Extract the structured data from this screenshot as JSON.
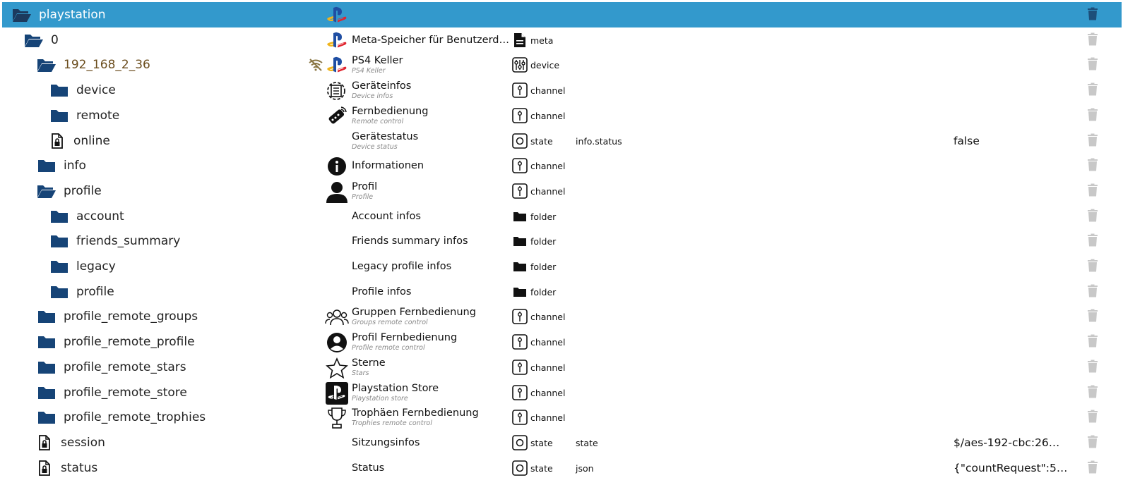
{
  "colors": {
    "selected_bg": "#3399cc",
    "folder": "#164477",
    "delete_icon": "#c8c8c8",
    "delete_icon_selected": "#1d4f7a",
    "device_name_color": "#6b4d1d",
    "connection_icon_color": "#8a7644"
  },
  "tree": [
    {
      "name": "playstation",
      "depth": 0,
      "icon": "folder-open-icon",
      "label": "",
      "sub": "",
      "type": "",
      "type_icon": "",
      "role": "",
      "value": "",
      "obj_icon": "playstation-logo-icon",
      "selected": true
    },
    {
      "name": "0",
      "depth": 1,
      "icon": "folder-open-icon",
      "label": "Meta-Speicher für Benutzerdat…",
      "sub": "",
      "type": "meta",
      "type_icon": "meta-file-icon",
      "role": "",
      "value": "",
      "obj_icon": "playstation-logo-icon"
    },
    {
      "name": "192_168_2_36",
      "depth": 2,
      "icon": "folder-open-icon",
      "label": "PS4 Keller",
      "sub": "PS4 Keller",
      "type": "device",
      "type_icon": "device-icon",
      "role": "",
      "value": "",
      "obj_icon": "playstation-logo-icon",
      "connection": "wifi-off-icon",
      "device": true
    },
    {
      "name": "device",
      "depth": 3,
      "icon": "folder-closed-icon",
      "label": "Geräteinfos",
      "sub": "Device infos",
      "type": "channel",
      "type_icon": "channel-icon",
      "role": "",
      "value": "",
      "obj_icon": "device-settings-icon"
    },
    {
      "name": "remote",
      "depth": 3,
      "icon": "folder-closed-icon",
      "label": "Fernbedienung",
      "sub": "Remote control",
      "type": "channel",
      "type_icon": "channel-icon",
      "role": "",
      "value": "",
      "obj_icon": "remote-control-icon"
    },
    {
      "name": "online",
      "depth": 3,
      "icon": "state-file-lock-icon",
      "label": "Gerätestatus",
      "sub": "Device status",
      "type": "state",
      "type_icon": "state-icon",
      "role": "info.status",
      "value": "false",
      "obj_icon": ""
    },
    {
      "name": "info",
      "depth": 2,
      "icon": "folder-closed-icon",
      "label": "Informationen",
      "sub": "",
      "type": "channel",
      "type_icon": "channel-icon",
      "role": "",
      "value": "",
      "obj_icon": "info-circle-icon"
    },
    {
      "name": "profile",
      "depth": 2,
      "icon": "folder-open-icon",
      "label": "Profil",
      "sub": "Profile",
      "type": "channel",
      "type_icon": "channel-icon",
      "role": "",
      "value": "",
      "obj_icon": "person-icon"
    },
    {
      "name": "account",
      "depth": 3,
      "icon": "folder-closed-icon",
      "label": "Account infos",
      "sub": "",
      "type": "folder",
      "type_icon": "folder-type-icon",
      "role": "",
      "value": "",
      "obj_icon": ""
    },
    {
      "name": "friends_summary",
      "depth": 3,
      "icon": "folder-closed-icon",
      "label": "Friends summary infos",
      "sub": "",
      "type": "folder",
      "type_icon": "folder-type-icon",
      "role": "",
      "value": "",
      "obj_icon": ""
    },
    {
      "name": "legacy",
      "depth": 3,
      "icon": "folder-closed-icon",
      "label": "Legacy profile infos",
      "sub": "",
      "type": "folder",
      "type_icon": "folder-type-icon",
      "role": "",
      "value": "",
      "obj_icon": ""
    },
    {
      "name": "profile",
      "depth": 3,
      "icon": "folder-closed-icon",
      "label": "Profile infos",
      "sub": "",
      "type": "folder",
      "type_icon": "folder-type-icon",
      "role": "",
      "value": "",
      "obj_icon": ""
    },
    {
      "name": "profile_remote_groups",
      "depth": 2,
      "icon": "folder-closed-icon",
      "label": "Gruppen Fernbedienung",
      "sub": "Groups remote control",
      "type": "channel",
      "type_icon": "channel-icon",
      "role": "",
      "value": "",
      "obj_icon": "group-icon"
    },
    {
      "name": "profile_remote_profile",
      "depth": 2,
      "icon": "folder-closed-icon",
      "label": "Profil Fernbedienung",
      "sub": "Profile remote control",
      "type": "channel",
      "type_icon": "channel-icon",
      "role": "",
      "value": "",
      "obj_icon": "account-circle-icon"
    },
    {
      "name": "profile_remote_stars",
      "depth": 2,
      "icon": "folder-closed-icon",
      "label": "Sterne",
      "sub": "Stars",
      "type": "channel",
      "type_icon": "channel-icon",
      "role": "",
      "value": "",
      "obj_icon": "star-icon"
    },
    {
      "name": "profile_remote_store",
      "depth": 2,
      "icon": "folder-closed-icon",
      "label": "Playstation Store",
      "sub": "Playstation store",
      "type": "channel",
      "type_icon": "channel-icon",
      "role": "",
      "value": "",
      "obj_icon": "playstation-store-icon"
    },
    {
      "name": "profile_remote_trophies",
      "depth": 2,
      "icon": "folder-closed-icon",
      "label": "Trophäen Fernbedienung",
      "sub": "Trophies remote control",
      "type": "channel",
      "type_icon": "channel-icon",
      "role": "",
      "value": "",
      "obj_icon": "trophy-icon"
    },
    {
      "name": "session",
      "depth": 2,
      "icon": "state-file-lock-icon",
      "label": "Sitzungsinfos",
      "sub": "",
      "type": "state",
      "type_icon": "state-icon",
      "role": "state",
      "value": "$/aes-192-cbc:26…",
      "obj_icon": ""
    },
    {
      "name": "status",
      "depth": 2,
      "icon": "state-file-lock-icon",
      "label": "Status",
      "sub": "",
      "type": "state",
      "type_icon": "state-icon",
      "role": "json",
      "value": "{\"countRequest\":5…",
      "obj_icon": ""
    }
  ]
}
